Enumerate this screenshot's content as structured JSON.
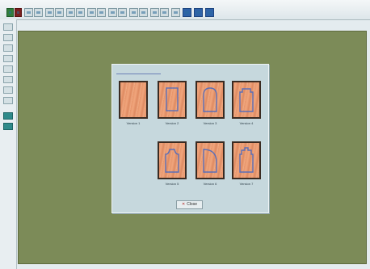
{
  "toolbar": {
    "buttons": [
      "new-icon",
      "open-icon",
      "save-icon",
      "cut-icon",
      "copy-icon",
      "paste-icon",
      "undo-icon",
      "redo-icon",
      "zoom-in-icon",
      "zoom-out-icon",
      "grid-icon",
      "select-icon",
      "draw-icon",
      "measure-icon",
      "rotate-icon",
      "mirror-icon",
      "layers-icon",
      "settings-icon",
      "preview-icon",
      "print-icon"
    ]
  },
  "left_toolbar": {
    "buttons": [
      "pointer-tool-icon",
      "line-tool-icon",
      "arc-tool-icon",
      "rect-tool-icon",
      "node-tool-icon",
      "trim-tool-icon",
      "offset-tool-icon",
      "dimension-tool-icon",
      "text-tool-icon",
      "layer-tool-icon"
    ]
  },
  "dialog": {
    "title": "",
    "tiles": [
      {
        "label": "Version 1",
        "shape": "plain"
      },
      {
        "label": "Version 2",
        "shape": "rect-inset"
      },
      {
        "label": "Version 3",
        "shape": "arch"
      },
      {
        "label": "Version 4",
        "shape": "notched"
      },
      {
        "label": "Version 5",
        "shape": "cathedral"
      },
      {
        "label": "Version 6",
        "shape": "quarter-arc"
      },
      {
        "label": "Version 7",
        "shape": "double-notch"
      }
    ],
    "close_label": "Close"
  },
  "colors": {
    "canvas": "#7c8b58",
    "dialog": "#c6d8dd",
    "wood": "#e7956b",
    "groove": "#5a6fb8"
  }
}
